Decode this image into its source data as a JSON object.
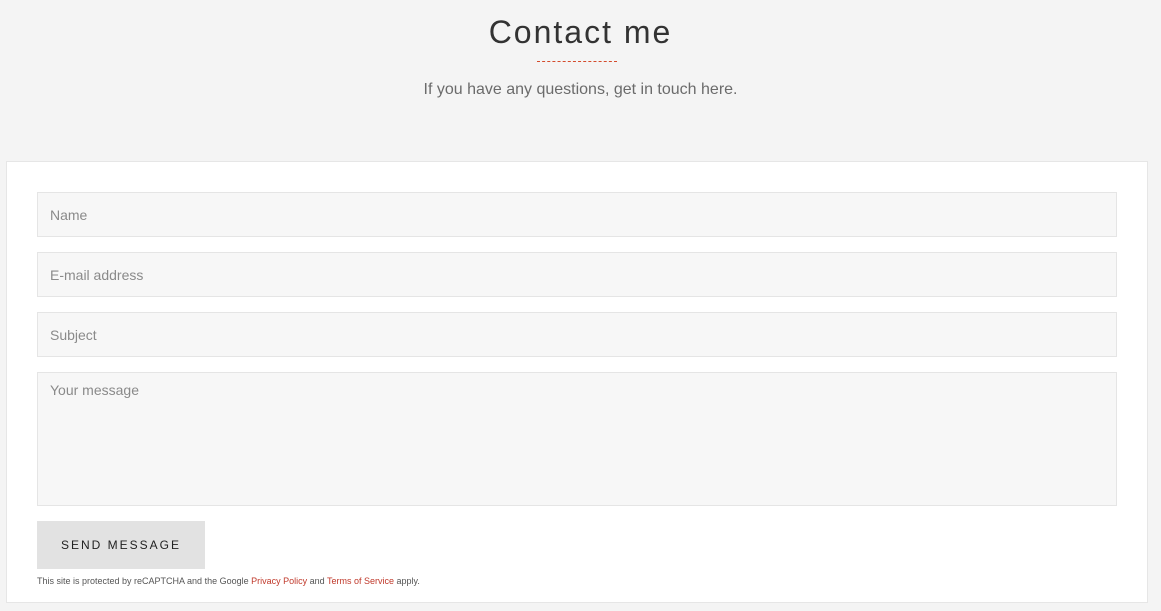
{
  "header": {
    "title": "Contact me",
    "subtitle": "If you have any questions, get in touch here."
  },
  "form": {
    "name_placeholder": "Name",
    "email_placeholder": "E-mail address",
    "subject_placeholder": "Subject",
    "message_placeholder": "Your message",
    "name_value": "",
    "email_value": "",
    "subject_value": "",
    "message_value": "",
    "submit_label": "SEND MESSAGE"
  },
  "recaptcha": {
    "prefix": "This site is protected by reCAPTCHA and the Google ",
    "privacy_label": "Privacy Policy",
    "middle": " and ",
    "terms_label": "Terms of Service",
    "suffix": " apply."
  },
  "colors": {
    "background": "#f4f4f4",
    "card": "#ffffff",
    "field": "#f7f7f7",
    "button": "#e2e2e2",
    "accent": "#d44b2c",
    "link": "#c0392b"
  }
}
